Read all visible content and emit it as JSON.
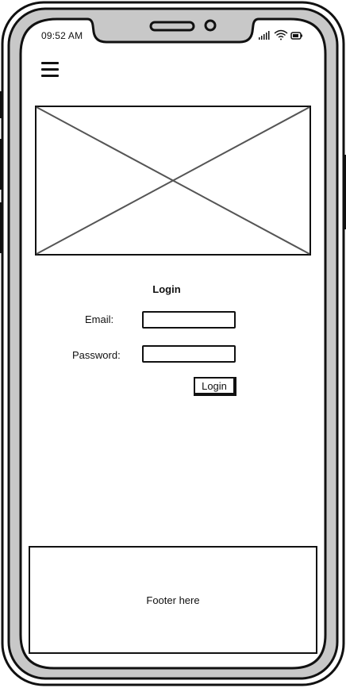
{
  "status_bar": {
    "time": "09:52 AM",
    "signal_icon": "signal-bars-icon",
    "wifi_icon": "wifi-icon",
    "battery_icon": "battery-icon"
  },
  "header": {
    "menu_icon": "hamburger-menu-icon"
  },
  "hero": {
    "image_icon": "image-placeholder-icon"
  },
  "login_form": {
    "title": "Login",
    "email_label": "Email:",
    "email_value": "",
    "password_label": "Password:",
    "password_value": "",
    "submit_label": "Login"
  },
  "footer": {
    "text": "Footer here"
  }
}
